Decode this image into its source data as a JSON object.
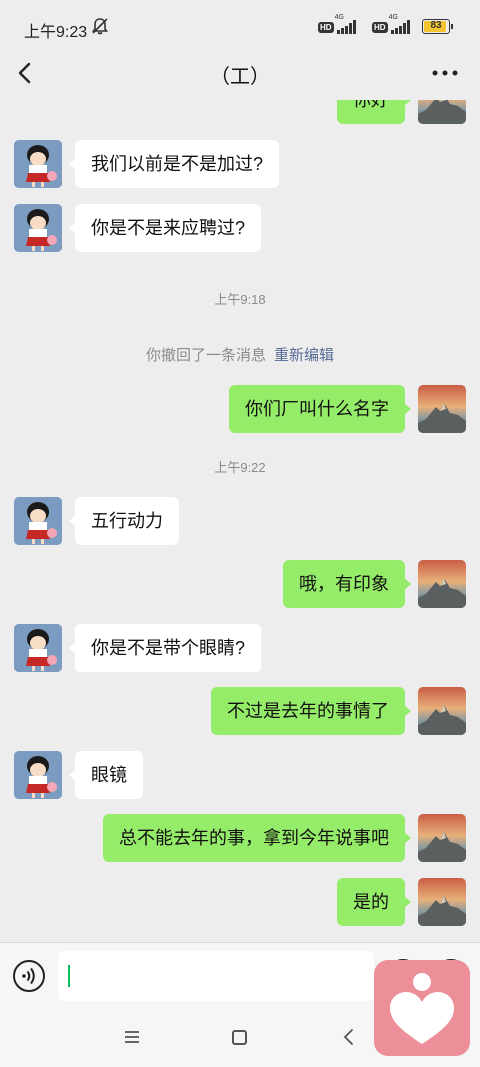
{
  "status": {
    "time": "上午9:23",
    "hd_label": "HD",
    "net_label": "4G",
    "battery": "83",
    "battery_fraction": 0.83
  },
  "header": {
    "title": "（工）"
  },
  "messages": [
    {
      "side": "out",
      "text": "你好"
    },
    {
      "side": "in",
      "text": "我们以前是不是加过?"
    },
    {
      "side": "in",
      "text": "你是不是来应聘过?"
    },
    {
      "side": "time",
      "text": "上午9:18"
    },
    {
      "side": "recall",
      "text": "你撤回了一条消息",
      "action": "重新编辑"
    },
    {
      "side": "out",
      "text": "你们厂叫什么名字"
    },
    {
      "side": "time",
      "text": "上午9:22"
    },
    {
      "side": "in",
      "text": "五行动力"
    },
    {
      "side": "out",
      "text": "哦，有印象"
    },
    {
      "side": "in",
      "text": "你是不是带个眼睛?"
    },
    {
      "side": "out",
      "text": "不过是去年的事情了"
    },
    {
      "side": "in",
      "text": "眼镜"
    },
    {
      "side": "out",
      "text": "总不能去年的事，拿到今年说事吧"
    },
    {
      "side": "out",
      "text": "是的"
    }
  ],
  "colors": {
    "bubble_out": "#95ec69",
    "bubble_in": "#ffffff",
    "background": "#ededed",
    "link": "#576b95",
    "overlay": "#ec8f98"
  },
  "icons": {
    "back": "chevron-left-icon",
    "more": "more-dots-icon",
    "voice": "voice-icon",
    "heart": "heart-icon"
  }
}
